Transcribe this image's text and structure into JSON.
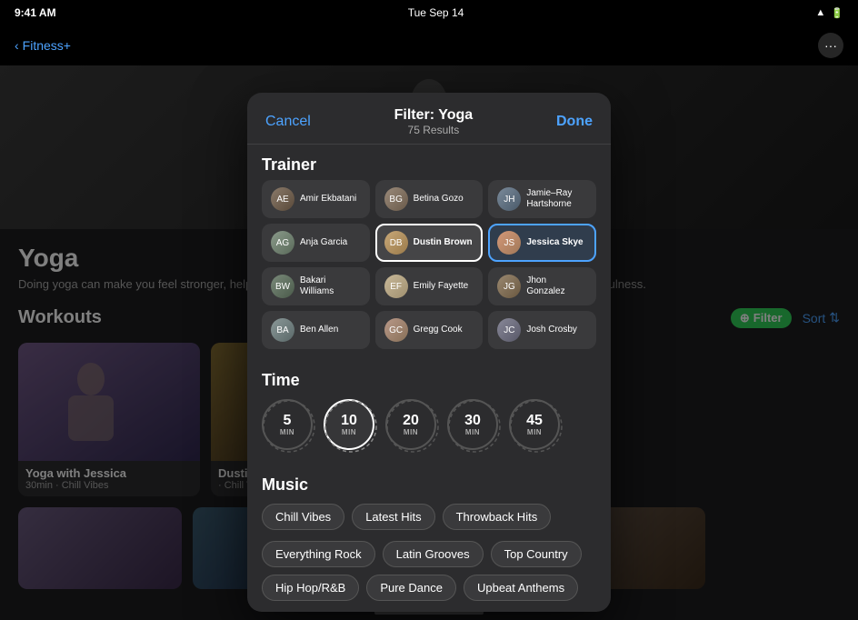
{
  "statusBar": {
    "time": "9:41 AM",
    "date": "Tue Sep 14",
    "wifi": "100%",
    "battery": "100%"
  },
  "navBar": {
    "backLabel": "Fitness+",
    "dotsIcon": "···"
  },
  "yogaPage": {
    "title": "Yoga",
    "description": "Doing yoga can make you feel stronger, help you increase overall fitness, improve balance, and encourage mindfulness.",
    "workoutsLabel": "Workouts",
    "filterLabel": "Filter",
    "sortLabel": "Sort"
  },
  "workoutCards": [
    {
      "title": "Yoga with Jessica",
      "meta": "30min · Chill Vibes",
      "colorClass": "card1"
    },
    {
      "title": "Dustin",
      "meta": "· Chill Vibes",
      "colorClass": "card2"
    },
    {
      "title": "",
      "meta": "",
      "colorClass": "card3"
    }
  ],
  "filterSheet": {
    "cancelLabel": "Cancel",
    "title": "Filter: Yoga",
    "resultsLabel": "75 Results",
    "doneLabel": "Done"
  },
  "trainerSection": {
    "label": "Trainer",
    "trainers": [
      {
        "name": "Amir Ekbatani",
        "avatarClass": "av-amir",
        "selected": false
      },
      {
        "name": "Betina Gozo",
        "avatarClass": "av-betina",
        "selected": false
      },
      {
        "name": "Jamie–Ray Hartshorne",
        "avatarClass": "av-jamie",
        "selected": false
      },
      {
        "name": "Anja Garcia",
        "avatarClass": "av-anja",
        "selected": false
      },
      {
        "name": "Dustin Brown",
        "avatarClass": "av-dustin",
        "selected": false,
        "bold": true
      },
      {
        "name": "Jessica Skye",
        "avatarClass": "av-jessica",
        "selected": true,
        "bold": true
      },
      {
        "name": "Bakari Williams",
        "avatarClass": "av-bakari",
        "selected": false
      },
      {
        "name": "Emily Fayette",
        "avatarClass": "av-emily",
        "selected": false
      },
      {
        "name": "Jhon Gonzalez",
        "avatarClass": "av-jhon",
        "selected": false
      },
      {
        "name": "Ben Allen",
        "avatarClass": "av-ben",
        "selected": false
      },
      {
        "name": "Gregg Cook",
        "avatarClass": "av-gregg",
        "selected": false
      },
      {
        "name": "Josh Crosby",
        "avatarClass": "av-josh",
        "selected": false
      }
    ]
  },
  "timeSection": {
    "label": "Time",
    "options": [
      {
        "value": "5",
        "unit": "MIN",
        "selected": false
      },
      {
        "value": "10",
        "unit": "MIN",
        "selected": true
      },
      {
        "value": "20",
        "unit": "MIN",
        "selected": false
      },
      {
        "value": "30",
        "unit": "MIN",
        "selected": false
      },
      {
        "value": "45",
        "unit": "MIN",
        "selected": false
      }
    ]
  },
  "musicSection": {
    "label": "Music",
    "tags": [
      {
        "label": "Chill Vibes",
        "selected": false
      },
      {
        "label": "Latest Hits",
        "selected": false
      },
      {
        "label": "Throwback Hits",
        "selected": false
      },
      {
        "label": "Everything Rock",
        "selected": false
      },
      {
        "label": "Latin Grooves",
        "selected": false
      },
      {
        "label": "Top Country",
        "selected": false
      },
      {
        "label": "Hip Hop/R&B",
        "selected": false
      },
      {
        "label": "Pure Dance",
        "selected": false
      },
      {
        "label": "Upbeat Anthems",
        "selected": false
      }
    ]
  },
  "homeIndicator": ""
}
